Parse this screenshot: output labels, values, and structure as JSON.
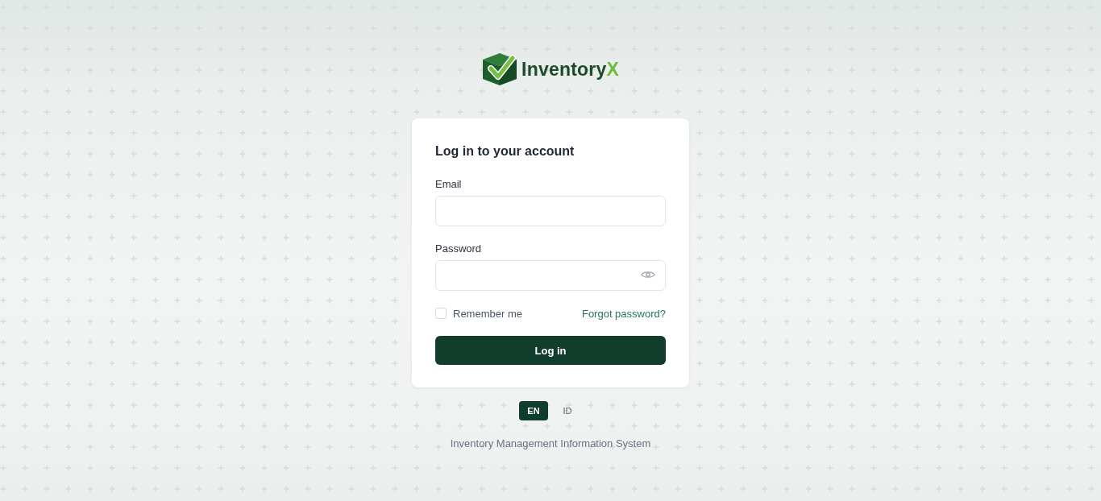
{
  "brand": {
    "name": "Inventory",
    "accent": "X"
  },
  "form": {
    "title": "Log in to your account",
    "fields": [
      {
        "kind": "email",
        "label": "Email"
      },
      {
        "kind": "password",
        "label": "Password"
      }
    ],
    "remember": {
      "label": "Remember me",
      "checked": false
    },
    "forgot_link": "Forgot password?",
    "submit": "Log in"
  },
  "languages": [
    {
      "label": "EN",
      "selected": true
    },
    {
      "label": "ID",
      "selected": false
    }
  ],
  "footer": "Inventory Management Information System"
}
